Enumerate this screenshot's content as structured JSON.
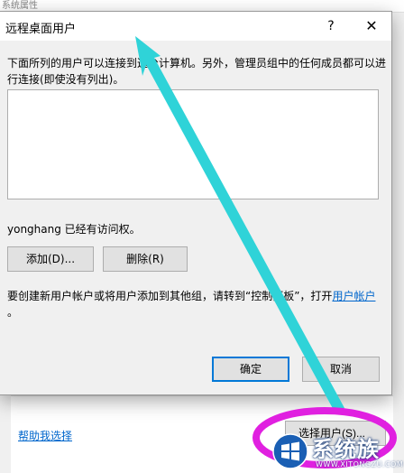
{
  "parent": {
    "caption": "系统属性",
    "help_link": "帮助我选择",
    "select_users_button": "选择用户(S)..."
  },
  "dialog": {
    "title": "远程桌面用户",
    "help_glyph": "?",
    "close_glyph": "✕",
    "description": "下面所列的用户可以连接到这台计算机。另外，管理员组中的任何成员都可以进行连接(即使没有列出)。",
    "access_text": "yonghang 已经有访问权。",
    "add_button": "添加(D)...",
    "remove_button": "删除(R)",
    "info_text": "要创建新用户帐户或将用户添加到其他组，请转到“控制面板”，打开",
    "info_link": "用户帐户",
    "info_tail": "。",
    "ok_button": "确定",
    "cancel_button": "取消"
  },
  "annotations": {
    "arrow_color": "#2fd3d8",
    "circle_color": "#e020e0"
  },
  "watermark": {
    "text": "系统族",
    "url": "WWW.XITONGZU.COM"
  }
}
